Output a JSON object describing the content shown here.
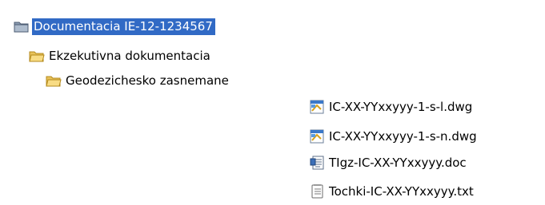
{
  "tree": {
    "root": {
      "label": "Documentacia IE-12-1234567",
      "icon": "folder-closed-gray-icon",
      "selected": true
    },
    "level1": {
      "label": "Ekzekutivna dokumentacia",
      "icon": "folder-icon"
    },
    "level2": {
      "label": "Geodezichesko zasnemane",
      "icon": "folder-icon"
    }
  },
  "files": [
    {
      "label": "IC-XX-YYxxyyy-1-s-l.dwg",
      "icon": "dwg-file-icon"
    },
    {
      "label": "IC-XX-YYxxyyy-1-s-n.dwg",
      "icon": "dwg-file-icon"
    },
    {
      "label": "TIgz-IC-XX-YYxxyyy.doc",
      "icon": "doc-file-icon"
    },
    {
      "label": "Tochki-IC-XX-YYxxyyy.txt",
      "icon": "txt-file-icon"
    }
  ],
  "colors": {
    "selection_bg": "#316ac5",
    "selection_text": "#ffffff",
    "folder_yellow": "#f5d36b",
    "folder_outline": "#b48a1c"
  }
}
